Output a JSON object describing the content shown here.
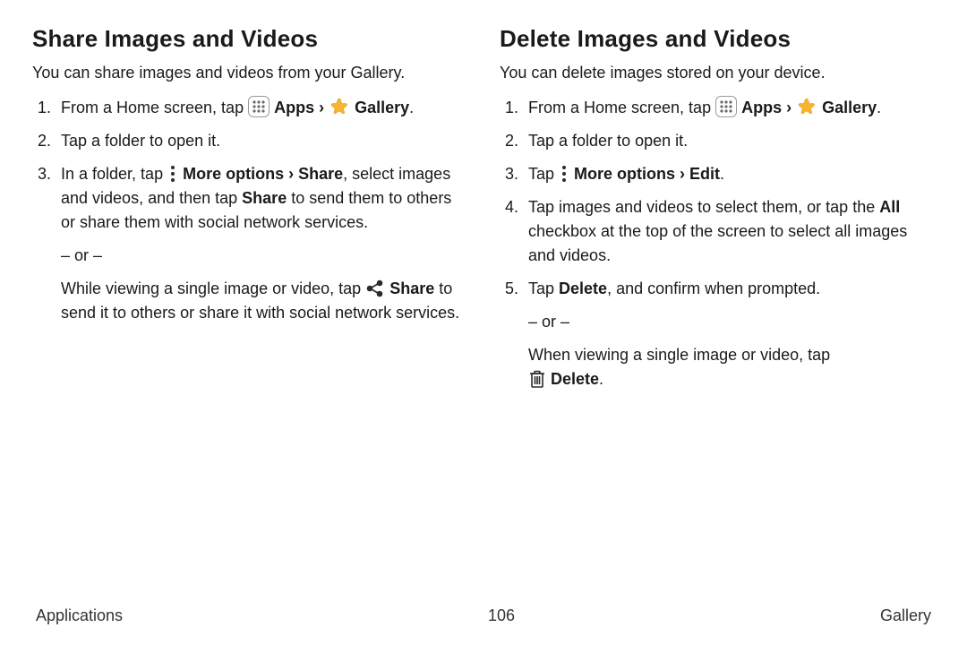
{
  "left": {
    "heading": "Share Images and Videos",
    "intro": "You can share images and videos from your Gallery.",
    "steps": {
      "s1_a": "From a Home screen, tap ",
      "apps": "Apps",
      "chev": " › ",
      "gallery": "Gallery",
      "s1_end": ".",
      "s2": "Tap a folder to open it.",
      "s3_a": "In a folder, tap ",
      "more": "More options",
      "share_path": " › Share",
      "s3_b": ", select images and videos, and then tap ",
      "share_bold": "Share",
      "s3_c": " to send them to others or share them with social network services.",
      "or": "– or –",
      "s3_d": "While viewing a single image or video, tap ",
      "share_bold2": "Share",
      "s3_e": " to send it to others or share it with social network services."
    }
  },
  "right": {
    "heading": "Delete Images and Videos",
    "intro": "You can delete images stored on your device.",
    "steps": {
      "s1_a": "From a Home screen, tap ",
      "apps": "Apps",
      "chev": " › ",
      "gallery": "Gallery",
      "s1_end": ".",
      "s2": "Tap a folder to open it.",
      "s3_a": "Tap ",
      "more": "More options",
      "edit_path": " › Edit",
      "s3_end": ".",
      "s4_a": "Tap images and videos to select them, or tap the ",
      "all": "All",
      "s4_b": " checkbox at the top of the screen to select all images and videos.",
      "s5_a": "Tap ",
      "delete": "Delete",
      "s5_b": ", and confirm when prompted.",
      "or": "– or –",
      "s5_c": "When viewing a single image or video, tap ",
      "delete2": "Delete",
      "s5_d": "."
    }
  },
  "footer": {
    "left": "Applications",
    "center": "106",
    "right": "Gallery"
  }
}
